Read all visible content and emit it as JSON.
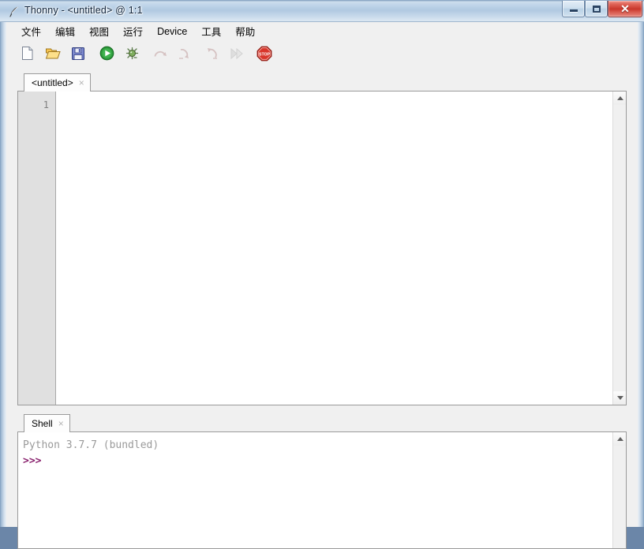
{
  "window": {
    "title": "Thonny  -  <untitled>  @  1:1",
    "app_icon": "feather-quill-icon",
    "controls": {
      "minimize_label": "—",
      "maximize_label": "□",
      "close_label": "✕"
    },
    "frame_color": "#b9d0e6",
    "close_color": "#c9372c"
  },
  "menubar": {
    "items": [
      {
        "label": "文件",
        "name": "menu-file"
      },
      {
        "label": "编辑",
        "name": "menu-edit"
      },
      {
        "label": "视图",
        "name": "menu-view"
      },
      {
        "label": "运行",
        "name": "menu-run"
      },
      {
        "label": "Device",
        "name": "menu-device"
      },
      {
        "label": "工具",
        "name": "menu-tools"
      },
      {
        "label": "帮助",
        "name": "menu-help"
      }
    ]
  },
  "toolbar": {
    "buttons": [
      {
        "icon": "new-file-icon",
        "enabled": true
      },
      {
        "icon": "open-folder-icon",
        "enabled": true
      },
      {
        "icon": "save-floppy-icon",
        "enabled": true
      },
      {
        "icon": "run-play-icon",
        "enabled": true
      },
      {
        "icon": "debug-bug-icon",
        "enabled": true
      },
      {
        "icon": "step-over-icon",
        "enabled": false
      },
      {
        "icon": "step-into-icon",
        "enabled": false
      },
      {
        "icon": "step-out-icon",
        "enabled": false
      },
      {
        "icon": "resume-icon",
        "enabled": false
      },
      {
        "icon": "stop-sign-icon",
        "enabled": true
      }
    ]
  },
  "editor": {
    "tab_label": "<untitled>",
    "tab_close": "×",
    "line_numbers": "1",
    "content": "",
    "scroll_up": "▲",
    "scroll_down": "▼"
  },
  "shell": {
    "tab_label": "Shell",
    "tab_close": "×",
    "banner": "Python 3.7.7 (bundled)",
    "prompt": ">>>",
    "prompt_color": "#8b2570",
    "banner_color": "#9a9a9a"
  }
}
